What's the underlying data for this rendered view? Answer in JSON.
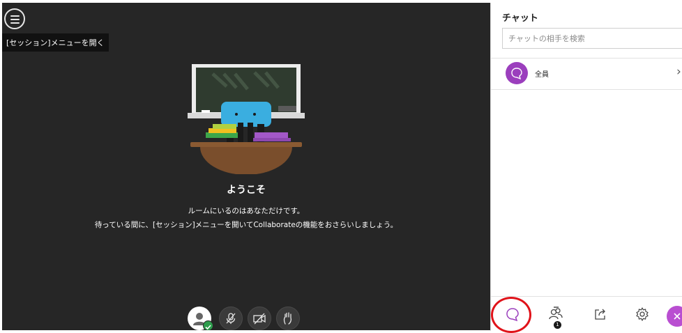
{
  "session_menu": {
    "tooltip": "[セッション]メニューを開く"
  },
  "welcome": {
    "title": "ようこそ",
    "line1": "ルームにいるのはあなただけです。",
    "line2": "待っている間に、[セッション]メニューを開いてCollaborateの機能をおさらいしましょう。"
  },
  "controls": {
    "items": [
      {
        "icon": "user-avatar-icon",
        "status": "check-icon"
      },
      {
        "icon": "microphone-off-icon"
      },
      {
        "icon": "camera-off-icon"
      },
      {
        "icon": "raise-hand-icon"
      }
    ]
  },
  "chat_panel": {
    "title": "チャット",
    "search": {
      "placeholder": "チャットの相手を検索",
      "value": ""
    },
    "conversations": [
      {
        "label": "全員",
        "icon": "chat-bubble-icon",
        "avatar_color": "#9b3fbd"
      }
    ]
  },
  "tabs": {
    "items": [
      {
        "icon": "chat-icon",
        "active": true
      },
      {
        "icon": "attendees-icon",
        "badge": "1"
      },
      {
        "icon": "share-content-icon"
      },
      {
        "icon": "settings-icon"
      },
      {
        "icon": "close-icon"
      }
    ]
  },
  "colors": {
    "stage_background": "#262626",
    "accent_purple": "#9b3fbd",
    "highlight_red": "#e0131a",
    "status_green": "#2e9d4d"
  }
}
